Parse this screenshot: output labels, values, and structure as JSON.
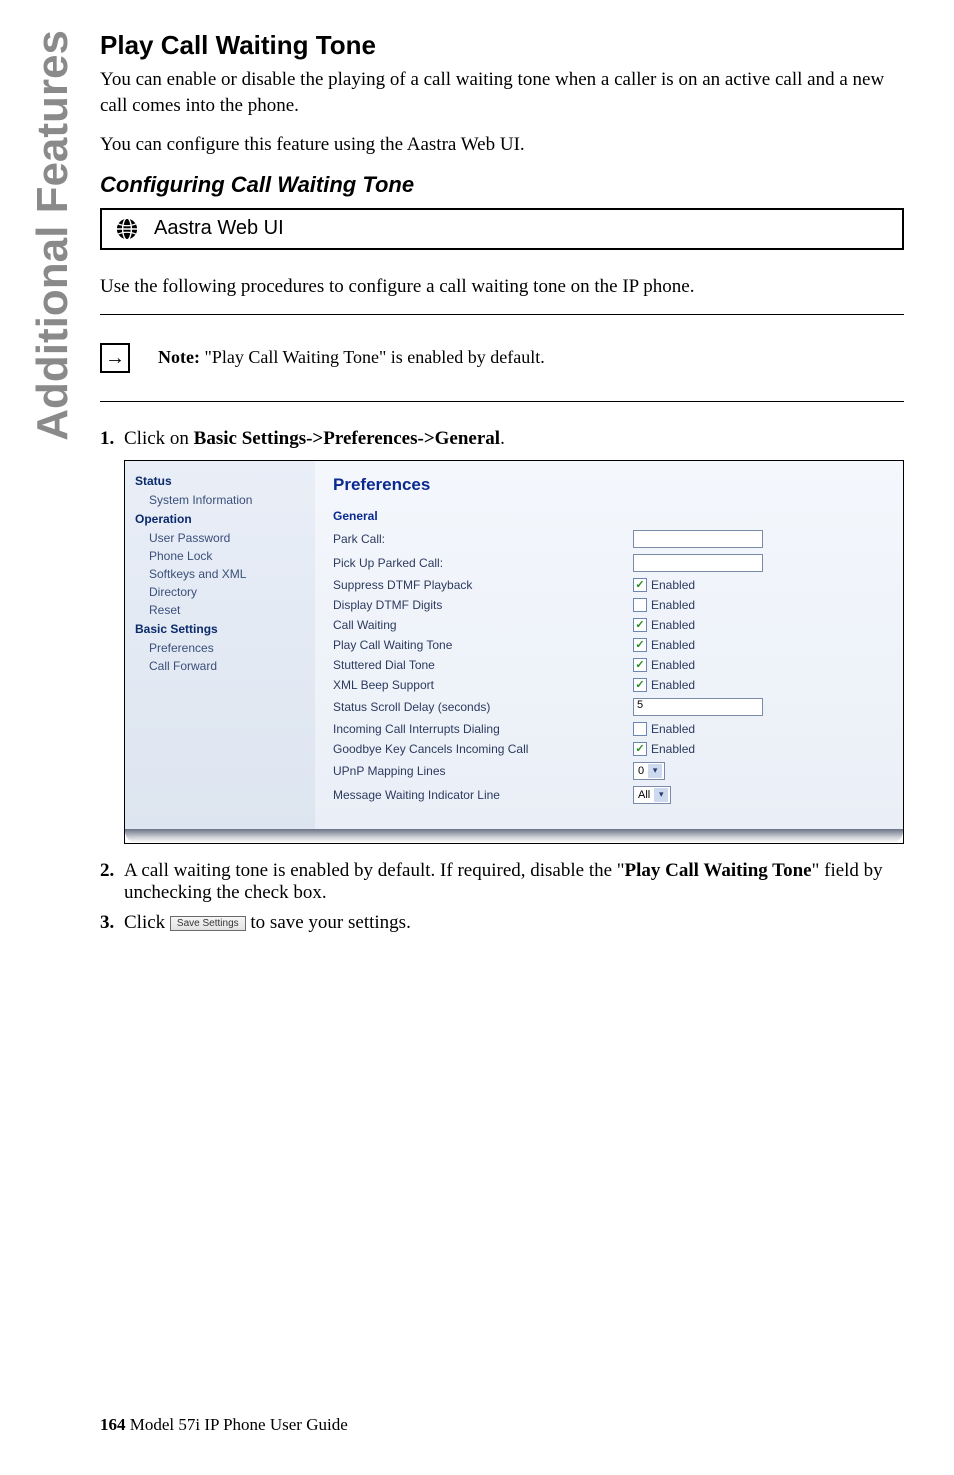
{
  "side_tab": "Additional Features",
  "title": "Play Call Waiting Tone",
  "intro1": "You can enable or disable the playing of a call waiting tone when a caller is on an active call and a new call comes into the phone.",
  "intro2": "You can configure this feature using the Aastra Web UI.",
  "subtitle": "Configuring Call Waiting Tone",
  "ui_box_label": "Aastra Web UI",
  "procedure_line": "Use the following procedures to configure a call waiting tone on the IP phone.",
  "note_label": "Note: ",
  "note_text": "\"Play Call Waiting Tone\" is enabled by default.",
  "step1_pre": "Click on ",
  "step1_bold": "Basic Settings->Preferences->General",
  "step1_post": ".",
  "step2_a": "A call waiting tone is enabled by default. If required, disable the \"",
  "step2_bold": "Play Call Waiting Tone",
  "step2_b": "\" field by unchecking the check box.",
  "step3_a": "Click ",
  "step3_btn": "Save Settings",
  "step3_b": " to save your settings.",
  "screenshot": {
    "nav": {
      "status_hdr": "Status",
      "system_info": "System Information",
      "operation_hdr": "Operation",
      "user_password": "User Password",
      "phone_lock": "Phone Lock",
      "softkeys": "Softkeys and XML",
      "directory": "Directory",
      "reset": "Reset",
      "basic_hdr": "Basic Settings",
      "preferences": "Preferences",
      "call_forward": "Call Forward"
    },
    "content_title": "Preferences",
    "group_general": "General",
    "rows": {
      "park_call": "Park Call:",
      "pick_up": "Pick Up Parked Call:",
      "suppress_dtmf": "Suppress DTMF Playback",
      "display_dtmf": "Display DTMF Digits",
      "call_waiting": "Call Waiting",
      "play_cw_tone": "Play Call Waiting Tone",
      "stuttered": "Stuttered Dial Tone",
      "xml_beep": "XML Beep Support",
      "status_scroll": "Status Scroll Delay (seconds)",
      "incoming_interrupts": "Incoming Call Interrupts Dialing",
      "goodbye": "Goodbye Key Cancels Incoming Call",
      "upnp": "UPnP Mapping Lines",
      "mwi": "Message Waiting Indicator Line"
    },
    "enabled_label": "Enabled",
    "status_scroll_value": "5",
    "upnp_value": "0",
    "mwi_value": "All"
  },
  "footer_page": "164",
  "footer_text": "  Model 57i IP Phone User Guide"
}
